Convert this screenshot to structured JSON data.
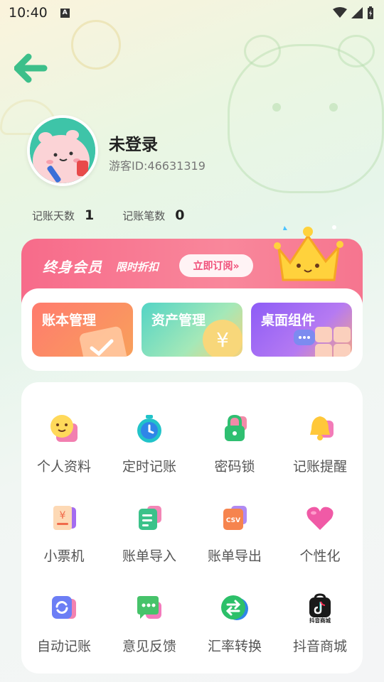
{
  "status_bar": {
    "time": "10:40",
    "a_badge": "A"
  },
  "header": {
    "back_icon": "arrow-left-icon"
  },
  "profile": {
    "username": "未登录",
    "guest_id": "游客ID:46631319"
  },
  "stats": {
    "days_label": "记账天数",
    "days_value": "1",
    "records_label": "记账笔数",
    "records_value": "0"
  },
  "vip": {
    "title": "终身会员",
    "subtitle": "限时折扣",
    "button_label": "立即订阅»"
  },
  "quick_cards": [
    {
      "label": "账本管理"
    },
    {
      "label": "资产管理"
    },
    {
      "label": "桌面组件"
    }
  ],
  "grid": [
    {
      "label": "个人资料",
      "icon": "smiley-profile-icon"
    },
    {
      "label": "定时记账",
      "icon": "timer-icon"
    },
    {
      "label": "密码锁",
      "icon": "lock-icon"
    },
    {
      "label": "记账提醒",
      "icon": "bell-icon"
    },
    {
      "label": "小票机",
      "icon": "receipt-icon"
    },
    {
      "label": "账单导入",
      "icon": "import-doc-icon"
    },
    {
      "label": "账单导出",
      "icon": "csv-export-icon"
    },
    {
      "label": "个性化",
      "icon": "heart-icon"
    },
    {
      "label": "自动记账",
      "icon": "auto-refresh-icon"
    },
    {
      "label": "意见反馈",
      "icon": "feedback-chat-icon"
    },
    {
      "label": "汇率转换",
      "icon": "exchange-icon"
    },
    {
      "label": "抖音商城",
      "icon": "douyin-mall-icon",
      "icon_text": "抖音商城"
    }
  ],
  "colors": {
    "accent_pink": "#f76b8a",
    "back_arrow": "#3cbf8a"
  }
}
